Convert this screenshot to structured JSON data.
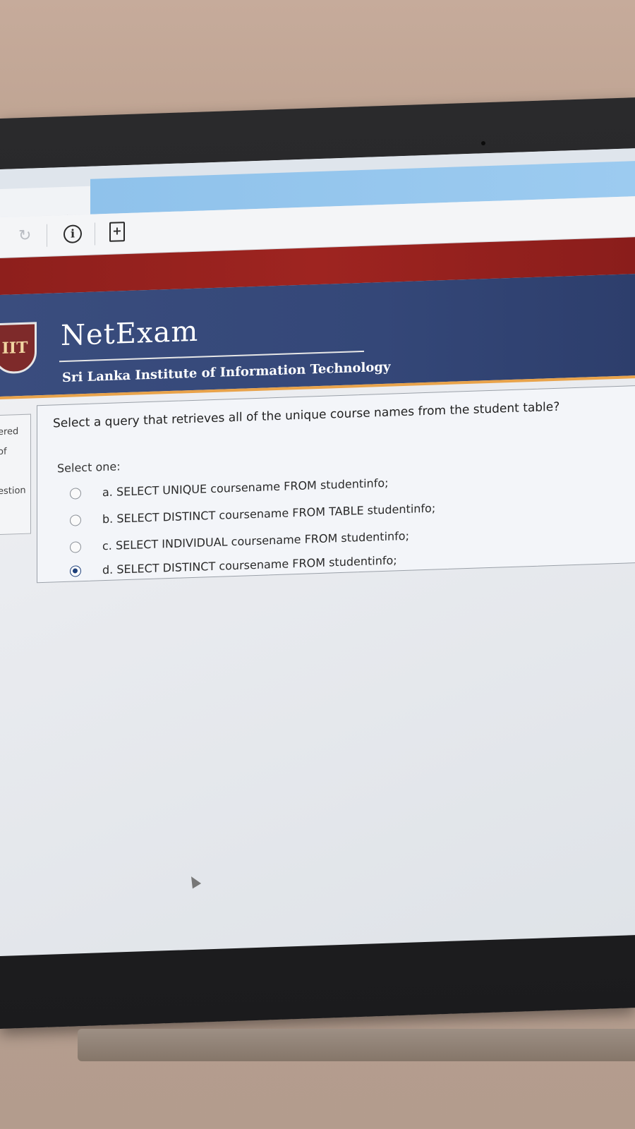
{
  "browser": {
    "tab_close_glyph": "✕",
    "reload_glyph": "↻",
    "info_glyph": "i",
    "newtab_glyph": "+"
  },
  "site": {
    "logo_text": "IIT",
    "brand_name": "NetExam",
    "tagline": "Sri Lanka Institute of Information Technology"
  },
  "left_panel": {
    "labels": [
      "ered",
      "of",
      "estion"
    ]
  },
  "question": {
    "prompt": "Select a query that retrieves all of the unique course names from the student table?",
    "instruction": "Select one:",
    "options": [
      {
        "label": "a. SELECT UNIQUE coursename FROM studentinfo;",
        "selected": false
      },
      {
        "label": "b. SELECT DISTINCT coursename FROM TABLE studentinfo;",
        "selected": false
      },
      {
        "label": "c. SELECT INDIVIDUAL coursename FROM studentinfo;",
        "selected": false
      },
      {
        "label": "d. SELECT DISTINCT coursename FROM studentinfo;",
        "selected": true
      }
    ]
  },
  "colors": {
    "header_blue": "#3a4d7e",
    "header_red": "#9e2420",
    "accent_orange": "#e9a34a",
    "radio_selected": "#1d3f7a"
  }
}
